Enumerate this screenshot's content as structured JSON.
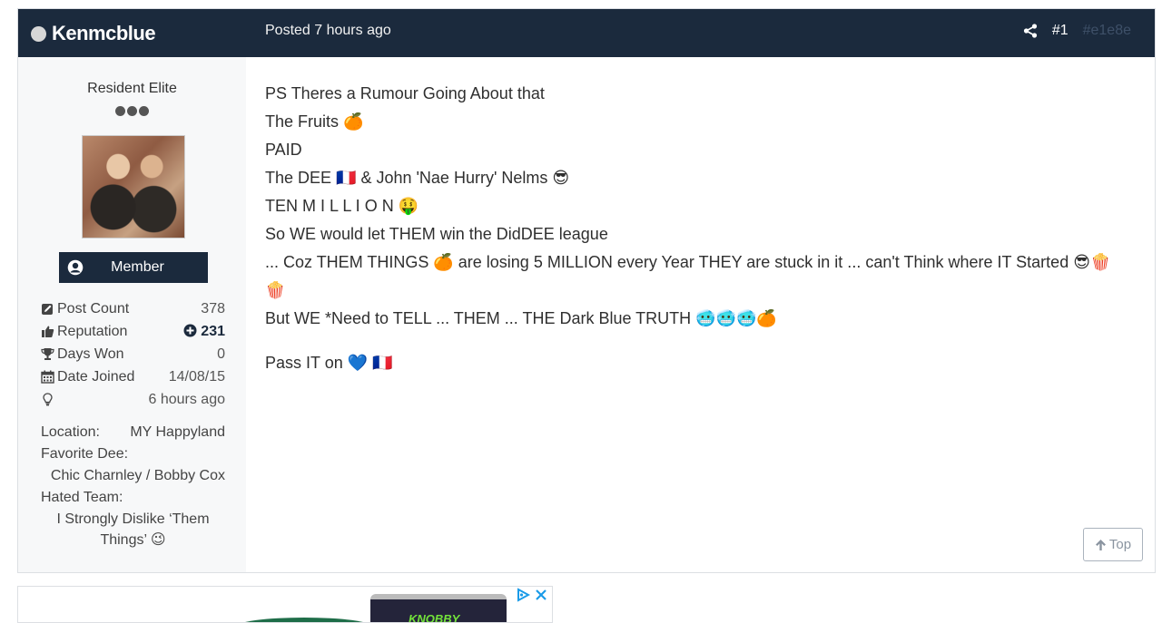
{
  "post": {
    "author": "Kenmcblue",
    "posted": "Posted 7 hours ago",
    "post_number": "#1",
    "hex_label": "#e1e8e",
    "rank": "Resident Elite",
    "member_group": "Member",
    "stats": [
      {
        "label": "Post Count",
        "value": "378",
        "icon": "pencil-square-icon",
        "bold": false
      },
      {
        "label": "Reputation",
        "value": "231",
        "icon": "thumbs-up-icon",
        "bold": true
      },
      {
        "label": "Days Won",
        "value": "0",
        "icon": "trophy-icon",
        "bold": false
      },
      {
        "label": "Date Joined",
        "value": "14/08/15",
        "icon": "calendar-icon",
        "bold": false
      },
      {
        "label": "",
        "value": "6 hours ago",
        "icon": "lightbulb-icon",
        "bold": false
      }
    ],
    "custom_fields": {
      "location_label": "Location:",
      "location_value": "MY Happyland",
      "favorite_label": "Favorite Dee:",
      "favorite_value": "Chic Charnley / Bobby Cox",
      "hated_label": "Hated Team:",
      "hated_value": "I Strongly Dislike ‘Them Things’ 😉"
    },
    "content_lines": [
      "PS Theres a Rumour Going About that",
      "The Fruits 🍊",
      "PAID",
      "The DEE 🇫🇷 & John 'Nae Hurry' Nelms 😎",
      "TEN  M I L L I O N 🤑",
      "So WE would let THEM win the DidDEE league",
      "... Coz THEM THINGS 🍊 are losing 5 MILLION every Year THEY are stuck in it ... can't Think where IT Started 😎🍿",
      "🍿",
      "But WE *Need to TELL ... THEM ... THE Dark Blue TRUTH 🥶🥶🥶🍊"
    ],
    "closing_line": "Pass IT on 💙 🇫🇷",
    "top_button": "Top"
  },
  "ad": {
    "brand_text": "KNOBBY"
  },
  "colors": {
    "header_bg": "#1b2a3d",
    "sidebar_bg": "#f7f8f9",
    "ad_icon": "#1a9be8"
  }
}
